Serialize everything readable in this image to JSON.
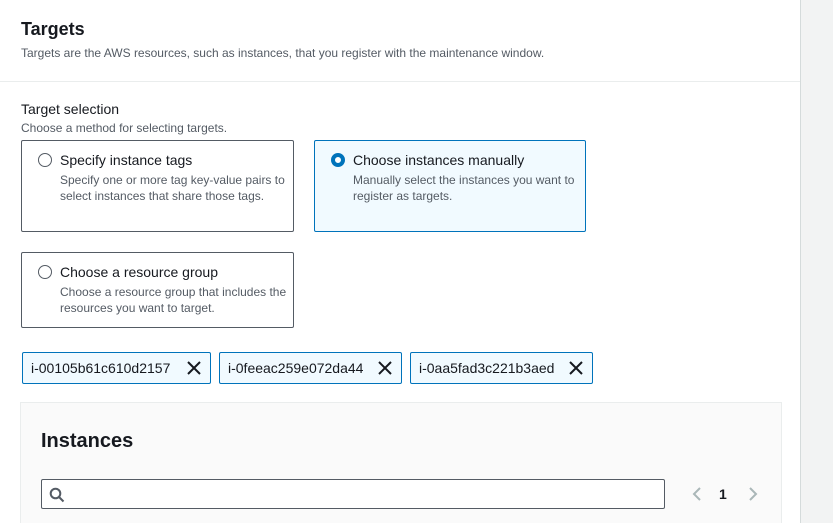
{
  "section": {
    "title": "Targets",
    "description": "Targets are the AWS resources, such as instances, that you register with the maintenance window."
  },
  "target_selection": {
    "label": "Target selection",
    "description": "Choose a method for selecting targets.",
    "options": [
      {
        "title": "Specify instance tags",
        "description": "Specify one or more tag key-value pairs to select instances that share those tags.",
        "selected": false
      },
      {
        "title": "Choose instances manually",
        "description": "Manually select the instances you want to register as targets.",
        "selected": true
      },
      {
        "title": "Choose a resource group",
        "description": "Choose a resource group that includes the resources you want to target.",
        "selected": false
      }
    ]
  },
  "tokens": [
    "i-00105b61c610d2157",
    "i-0feeac259e072da44",
    "i-0aa5fad3c221b3aed"
  ],
  "instances": {
    "title": "Instances",
    "search_value": "",
    "page": "1"
  },
  "colors": {
    "accent": "#0073bb",
    "selected_bg": "#f1faff",
    "text": "#16191f",
    "secondary_text": "#545b64"
  }
}
